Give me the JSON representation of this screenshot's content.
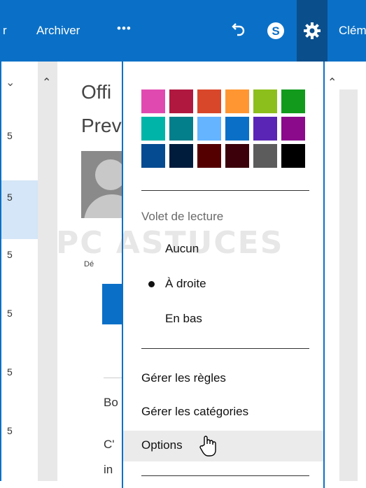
{
  "toolbar": {
    "partial_left": "r",
    "archive_label": "Archiver",
    "more_label": "•••",
    "user_partial": "Clém",
    "settings_active_bg": "#0a4e8c",
    "bar_bg": "#0a70c7"
  },
  "message_list": {
    "dates": [
      "5",
      "5",
      "5",
      "5",
      "5",
      "5"
    ]
  },
  "reading_pane": {
    "title_line1": "Offi",
    "title_line2": "Prev",
    "meta_partial": "Dé",
    "body_line1": "Bo",
    "body_line2": "C'",
    "body_line3": "in"
  },
  "theme_colors": [
    "#e04ab0",
    "#b0183f",
    "#d9472b",
    "#ff9632",
    "#8cbf1c",
    "#129a1c",
    "#00b5a8",
    "#037e8b",
    "#65b4ff",
    "#0a70c7",
    "#5a25b5",
    "#8b0a8c",
    "#054b91",
    "#001c3d",
    "#550000",
    "#3b0009",
    "#5c5c5c",
    "#000000"
  ],
  "reading_pane_settings": {
    "title": "Volet de lecture",
    "options": [
      {
        "label": "Aucun",
        "selected": false
      },
      {
        "label": "À droite",
        "selected": true
      },
      {
        "label": "En bas",
        "selected": false
      }
    ]
  },
  "menu": {
    "manage_rules": "Gérer les règles",
    "manage_categories": "Gérer les catégories",
    "options": "Options"
  },
  "watermark": "PC ASTUCES"
}
